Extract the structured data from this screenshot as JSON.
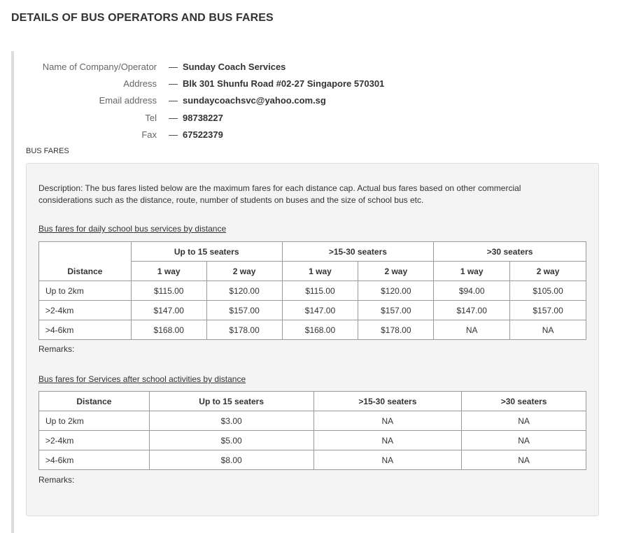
{
  "page_title": "DETAILS OF BUS OPERATORS AND BUS FARES",
  "operator": {
    "dash": "—",
    "fields": [
      {
        "label": "Name of Company/Operator",
        "value": "Sunday Coach Services"
      },
      {
        "label": "Address",
        "value": "Blk 301 Shunfu Road #02-27 Singapore 570301"
      },
      {
        "label": "Email address",
        "value": "sundaycoachsvc@yahoo.com.sg"
      },
      {
        "label": "Tel",
        "value": "98738227"
      },
      {
        "label": "Fax",
        "value": "67522379"
      }
    ]
  },
  "bus_fares_label": "BUS FARES",
  "description": "Description: The bus fares listed below are the maximum fares for each distance cap. Actual bus fares based on other commercial considerations such as the distance, route, number of students on buses and the size of school bus etc.",
  "daily": {
    "heading": "Bus fares for daily school bus services by distance",
    "distance_header": "Distance",
    "groups": [
      "Up to 15 seaters",
      ">15-30 seaters",
      ">30 seaters"
    ],
    "subheaders": [
      "1 way",
      "2 way",
      "1 way",
      "2 way",
      "1 way",
      "2 way"
    ],
    "rows": [
      {
        "distance": "Up to 2km",
        "fares": [
          "$115.00",
          "$120.00",
          "$115.00",
          "$120.00",
          "$94.00",
          "$105.00"
        ]
      },
      {
        "distance": ">2-4km",
        "fares": [
          "$147.00",
          "$157.00",
          "$147.00",
          "$157.00",
          "$147.00",
          "$157.00"
        ]
      },
      {
        "distance": ">4-6km",
        "fares": [
          "$168.00",
          "$178.00",
          "$168.00",
          "$178.00",
          "NA",
          "NA"
        ]
      }
    ],
    "remarks": "Remarks:"
  },
  "after_school": {
    "heading": "Bus fares for Services after school activities by distance",
    "headers": [
      "Distance",
      "Up to 15 seaters",
      ">15-30 seaters",
      ">30 seaters"
    ],
    "rows": [
      {
        "distance": "Up to 2km",
        "fares": [
          "$3.00",
          "NA",
          "NA"
        ]
      },
      {
        "distance": ">2-4km",
        "fares": [
          "$5.00",
          "NA",
          "NA"
        ]
      },
      {
        "distance": ">4-6km",
        "fares": [
          "$8.00",
          "NA",
          "NA"
        ]
      }
    ],
    "remarks": "Remarks:"
  }
}
